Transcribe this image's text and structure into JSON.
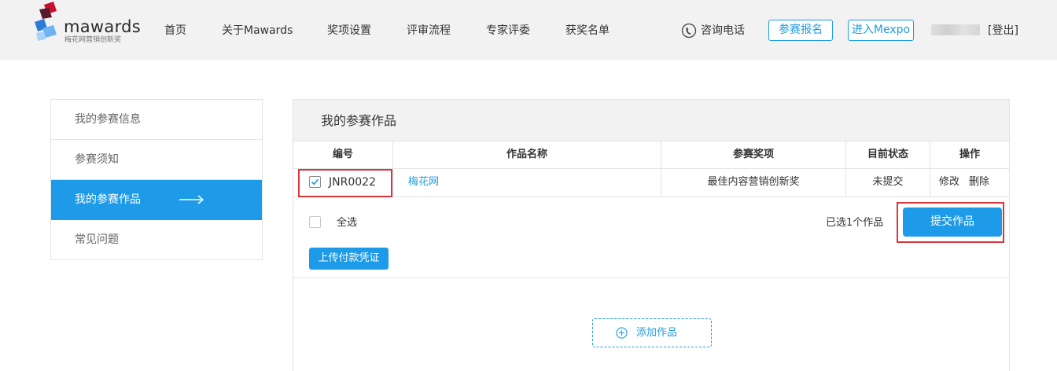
{
  "brand": {
    "name": "mawards",
    "tagline": "梅花网营销创新奖",
    "colors": {
      "accent": "#1e9be8",
      "highlight": "#d9363e",
      "logo_dark": "#5a1a2e",
      "logo_red": "#c8102e",
      "logo_blue": "#2b7bd8"
    }
  },
  "nav": {
    "items": [
      "首页",
      "关于Mawards",
      "奖项设置",
      "评审流程",
      "专家评委",
      "获奖名单"
    ],
    "phone_label": "咨询电话",
    "register_label": "参赛报名",
    "mexpo_label": "进入Mexpo",
    "logout_label": "[登出]"
  },
  "sidebar": {
    "items": [
      {
        "label": "我的参赛信息",
        "active": false
      },
      {
        "label": "参赛须知",
        "active": false
      },
      {
        "label": "我的参赛作品",
        "active": true
      },
      {
        "label": "常见问题",
        "active": false
      }
    ]
  },
  "main": {
    "title": "我的参赛作品",
    "columns": [
      "编号",
      "作品名称",
      "参赛奖项",
      "目前状态",
      "操作"
    ],
    "rows": [
      {
        "checked": true,
        "id": "JNR0022",
        "name": "梅花网",
        "award": "最佳内容营销创新奖",
        "status": "未提交",
        "edit_label": "修改",
        "delete_label": "删除"
      }
    ],
    "select_all_label": "全选",
    "selected_count_text": "已选1个作品",
    "submit_label": "提交作品",
    "upload_label": "上传付款凭证",
    "add_label": "添加作品"
  }
}
